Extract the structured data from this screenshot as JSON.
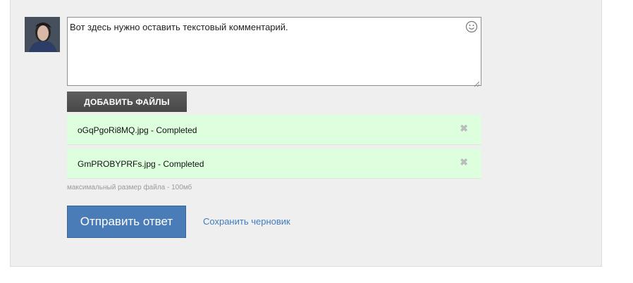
{
  "comment": {
    "text": "Вот здесь нужно оставить текстовый комментарий."
  },
  "add_files_label": "ДОБАВИТЬ ФАЙЛЫ",
  "files": [
    {
      "name": "oGqPgoRi8MQ.jpg - Completed"
    },
    {
      "name": "GmPROBYPRFs.jpg - Completed"
    }
  ],
  "file_size_hint": "максимальный размер файла - 100мб",
  "submit_label": "Отправить ответ",
  "save_draft_label": "Сохранить черновик",
  "colors": {
    "submit_bg": "#4a7db8",
    "file_row_bg": "#deffde",
    "link": "#3f7bbd"
  }
}
